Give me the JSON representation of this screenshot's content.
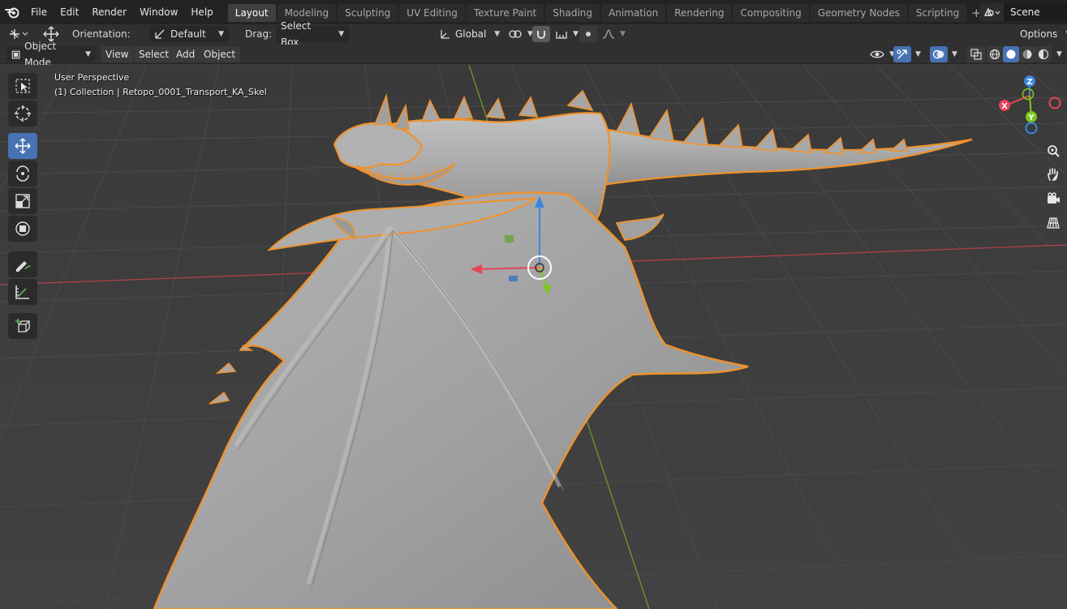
{
  "menu": {
    "items": [
      "File",
      "Edit",
      "Render",
      "Window",
      "Help"
    ]
  },
  "workspaces": {
    "tabs": [
      "Layout",
      "Modeling",
      "Sculpting",
      "UV Editing",
      "Texture Paint",
      "Shading",
      "Animation",
      "Rendering",
      "Compositing",
      "Geometry Nodes",
      "Scripting"
    ],
    "active": "Layout"
  },
  "scene": {
    "name": "Scene"
  },
  "toolbar": {
    "orientation_label": "Orientation:",
    "orientation_value": "Default",
    "drag_label": "Drag:",
    "drag_value": "Select Box",
    "transform_orientation": "Global",
    "options_label": "Options"
  },
  "header": {
    "mode": "Object Mode",
    "view": "View",
    "select": "Select",
    "add": "Add",
    "object": "Object"
  },
  "viewport": {
    "perspective": "User Perspective",
    "collection_info": "(1) Collection | Retopo_0001_Transport_KA_Skel"
  },
  "gizmo": {
    "x_label": "X",
    "y_label": "Y",
    "z_label": "Z",
    "x_color": "#e8445a",
    "y_color": "#7ec71e",
    "z_color": "#3a87e0"
  },
  "colors": {
    "selection_outline": "#f0922b",
    "active_tool": "#4772b3",
    "grid_x_axis": "#b3404a",
    "grid_y_axis": "#6a9a2a"
  }
}
